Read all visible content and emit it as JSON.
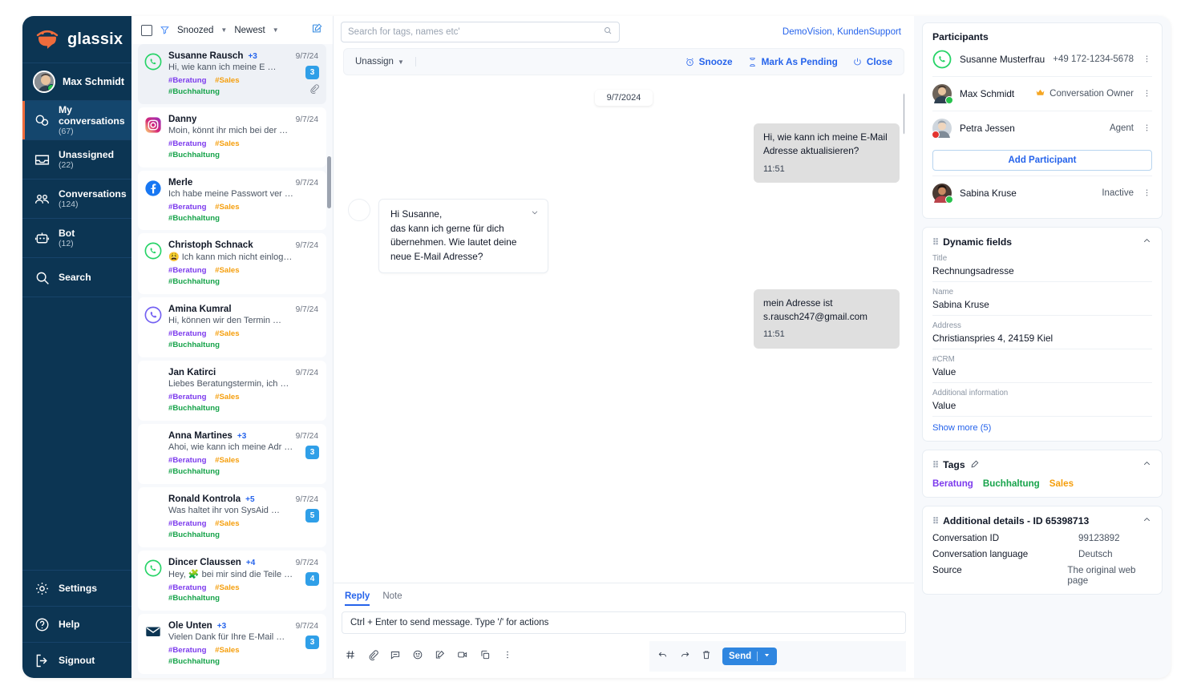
{
  "brand": {
    "name": "glassix",
    "logo_icon": "glassix-smile-logo"
  },
  "sidebar": {
    "user": {
      "name": "Max Schmidt",
      "status": "online"
    },
    "items": [
      {
        "label": "My conversations",
        "count": "(67)",
        "icon": "chat-bubbles-icon",
        "active": true
      },
      {
        "label": "Unassigned",
        "count": "(22)",
        "icon": "inbox-icon",
        "active": false
      },
      {
        "label": "Conversations",
        "count": "(124)",
        "icon": "people-icon",
        "active": false
      },
      {
        "label": "Bot",
        "count": "(12)",
        "icon": "robot-icon",
        "active": false
      },
      {
        "label": "Search",
        "count": "",
        "icon": "search-icon",
        "active": false
      }
    ],
    "bottom": [
      {
        "label": "Settings",
        "icon": "gear-icon"
      },
      {
        "label": "Help",
        "icon": "question-circle-icon"
      },
      {
        "label": "Signout",
        "icon": "logout-icon"
      }
    ]
  },
  "list_toolbar": {
    "filter_icon": "funnel-icon",
    "snoozed_label": "Snoozed",
    "sort_label": "Newest",
    "compose_icon": "compose-icon"
  },
  "conversations": [
    {
      "name": "Susanne Rausch",
      "plus": "+3",
      "date": "9/7/24",
      "preview": "Hi, wie kann ich meine E …",
      "badge": "3",
      "channel": "whatsapp",
      "selected": true,
      "attachment": true,
      "tags": {
        "a": "#Beratung",
        "b": "#Sales",
        "c": "#Buchhaltung"
      }
    },
    {
      "name": "Danny",
      "plus": "",
      "date": "9/7/24",
      "preview": "Moin, könnt ihr mich bei der …",
      "badge": "",
      "channel": "instagram",
      "selected": false,
      "attachment": false,
      "tags": {
        "a": "#Beratung",
        "b": "#Sales",
        "c": "#Buchhaltung"
      }
    },
    {
      "name": "Merle",
      "plus": "",
      "date": "9/7/24",
      "preview": "Ich habe meine Passwort ver …",
      "badge": "",
      "channel": "facebook",
      "selected": false,
      "attachment": false,
      "tags": {
        "a": "#Beratung",
        "b": "#Sales",
        "c": "#Buchhaltung"
      }
    },
    {
      "name": "Christoph Schnack",
      "plus": "",
      "date": "9/7/24",
      "preview": "😩 Ich kann mich nicht einloggen …",
      "badge": "",
      "channel": "whatsapp",
      "selected": false,
      "attachment": false,
      "tags": {
        "a": "#Beratung",
        "b": "#Sales",
        "c": "#Buchhaltung"
      }
    },
    {
      "name": "Amina Kumral",
      "plus": "",
      "date": "9/7/24",
      "preview": "Hi, können wir den Termin …",
      "badge": "",
      "channel": "viber",
      "selected": false,
      "attachment": false,
      "tags": {
        "a": "#Beratung",
        "b": "#Sales",
        "c": "#Buchhaltung"
      }
    },
    {
      "name": "Jan Katirci",
      "plus": "",
      "date": "9/7/24",
      "preview": "Liebes Beratungstermin, ich  …",
      "badge": "",
      "channel": "none",
      "selected": false,
      "attachment": false,
      "tags": {
        "a": "#Beratung",
        "b": "#Sales",
        "c": "#Buchhaltung"
      }
    },
    {
      "name": "Anna Martines",
      "plus": "+3",
      "date": "9/7/24",
      "preview": "Ahoi, wie kann ich meine Adr …",
      "badge": "3",
      "channel": "none",
      "selected": false,
      "attachment": false,
      "tags": {
        "a": "#Beratung",
        "b": "#Sales",
        "c": "#Buchhaltung"
      }
    },
    {
      "name": "Ronald Kontrola",
      "plus": "+5",
      "date": "9/7/24",
      "preview": "Was haltet ihr von SysAid …",
      "badge": "5",
      "channel": "none",
      "selected": false,
      "attachment": false,
      "tags": {
        "a": "#Beratung",
        "b": "#Sales",
        "c": "#Buchhaltung"
      }
    },
    {
      "name": "Dincer Claussen",
      "plus": "+4",
      "date": "9/7/24",
      "preview": "Hey, 🧩 bei mir sind die Teile …",
      "badge": "4",
      "channel": "whatsapp",
      "selected": false,
      "attachment": false,
      "tags": {
        "a": "#Beratung",
        "b": "#Sales",
        "c": "#Buchhaltung"
      }
    },
    {
      "name": "Ole Unten",
      "plus": "+3",
      "date": "9/7/24",
      "preview": "Vielen Dank für Ihre E-Mail …",
      "badge": "3",
      "channel": "email",
      "selected": false,
      "attachment": false,
      "tags": {
        "a": "#Beratung",
        "b": "#Sales",
        "c": "#Buchhaltung"
      }
    }
  ],
  "topbar": {
    "search_placeholder": "Search for tags, names etc'",
    "search_value": "",
    "search_icon": "search-icon",
    "org": "DemoVision, KundenSupport"
  },
  "conversation_actions": {
    "unassign_label": "Unassign",
    "snooze_label": "Snooze",
    "snooze_icon": "alarm-clock-icon",
    "pending_label": "Mark As Pending",
    "pending_icon": "hourglass-icon",
    "close_label": "Close",
    "close_icon": "power-icon"
  },
  "thread": {
    "day": "9/7/2024",
    "messages": [
      {
        "dir": "in",
        "text": "Hi, wie kann ich meine E-Mail Adresse aktualisieren?",
        "time": "11:51"
      },
      {
        "dir": "out",
        "line1": "Hi Susanne,",
        "line2": "das kann ich gerne für dich übernehmen. Wie lautet deine neue E-Mail Adresse?",
        "collapse_icon": "chevron-down-icon"
      },
      {
        "dir": "in",
        "text": "mein Adresse ist s.rausch247@gmail.com",
        "time": "11:51"
      }
    ]
  },
  "composer": {
    "tab_reply": "Reply",
    "tab_note": "Note",
    "input_placeholder": "Ctrl + Enter to send message. Type '/' for actions",
    "tools": [
      "hash-icon",
      "paperclip-icon",
      "canned-response-icon",
      "emoji-icon",
      "signature-icon",
      "video-icon",
      "duplicate-icon",
      "more-vertical-icon"
    ],
    "right_tools": [
      "undo-icon",
      "redo-icon",
      "trash-icon"
    ],
    "send_label": "Send",
    "send_caret_icon": "caret-down-icon"
  },
  "right_panel": {
    "participants": {
      "title": "Participants",
      "rows": [
        {
          "name": "Susanne Musterfrau",
          "meta": "+49 172-1234-5678",
          "icon": "whatsapp-icon",
          "role_icon": ""
        },
        {
          "name": "Max Schmidt",
          "meta": "Conversation Owner",
          "icon": "avatar",
          "role_icon": "crown-icon"
        },
        {
          "name": "Petra Jessen",
          "meta": "Agent",
          "icon": "avatar",
          "role_icon": ""
        }
      ],
      "add_label": "Add Participant",
      "inactive": {
        "name": "Sabina Kruse",
        "meta": "Inactive",
        "icon": "avatar"
      }
    },
    "dynamic_fields": {
      "title": "Dynamic fields",
      "collapse_icon": "chevron-up-icon",
      "fields": [
        {
          "k": "Title",
          "v": "Rechnungsadresse"
        },
        {
          "k": "Name",
          "v": "Sabina Kruse"
        },
        {
          "k": "Address",
          "v": "Christianspries 4, 24159 Kiel"
        },
        {
          "k": "#CRM",
          "v": "Value"
        },
        {
          "k": "Additional information",
          "v": "Value"
        }
      ],
      "show_more": "Show more (5)"
    },
    "tags": {
      "title": "Tags",
      "edit_icon": "pencil-icon",
      "collapse_icon": "chevron-up-icon",
      "items": [
        {
          "label": "Beratung",
          "color": "#7c3aed"
        },
        {
          "label": "Buchhaltung",
          "color": "#16a34a"
        },
        {
          "label": "Sales",
          "color": "#f59e0b"
        }
      ]
    },
    "additional": {
      "title": "Additional details -  ID 65398713",
      "collapse_icon": "chevron-up-icon",
      "rows": [
        {
          "k": "Conversation ID",
          "v": "99123892"
        },
        {
          "k": "Conversation language",
          "v": "Deutsch"
        },
        {
          "k": "Source",
          "v": "The original web page"
        }
      ]
    }
  },
  "colors": {
    "nav_bg": "#0c3553",
    "nav_active": "#14466d",
    "accent_orange": "#ef6c3c",
    "link_blue": "#2563eb",
    "badge_blue": "#2f9fe8",
    "send_blue": "#2f86e0"
  }
}
